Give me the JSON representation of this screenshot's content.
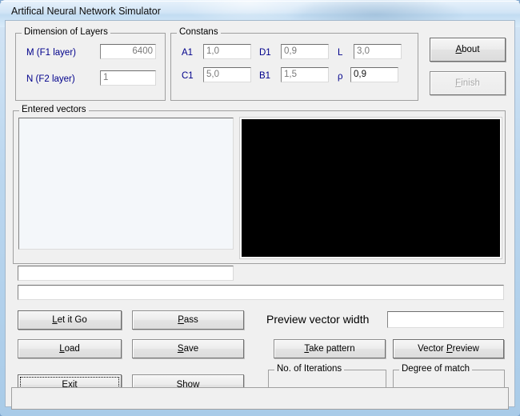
{
  "window": {
    "title": "Artifical Neural Network Simulator"
  },
  "dimension_group": {
    "legend": "Dimension of Layers",
    "fields": [
      {
        "label": "M (F1 layer)",
        "value": "6400",
        "align": "right"
      },
      {
        "label": "N (F2 layer)",
        "value": "1",
        "align": "left"
      }
    ]
  },
  "constants_group": {
    "legend": "Constans",
    "fields": [
      {
        "label": "A1",
        "value": "1,0"
      },
      {
        "label": "D1",
        "value": "0,9"
      },
      {
        "label": "L",
        "value": "3,0"
      },
      {
        "label": "C1",
        "value": "5,0"
      },
      {
        "label": "B1",
        "value": "1,5"
      },
      {
        "label": "ρ",
        "value": "0,9"
      }
    ]
  },
  "top_buttons": {
    "about": {
      "label_pre": "",
      "accel": "A",
      "label_post": "bout",
      "disabled": false
    },
    "finish": {
      "label_pre": "",
      "accel": "F",
      "label_post": "inish",
      "disabled": true
    }
  },
  "entered_vectors_group": {
    "legend": "Entered vectors",
    "listbox_value": "",
    "vector_field_value": "",
    "status_field_value": ""
  },
  "preview": {
    "panel_color": "#000000"
  },
  "action_buttons": [
    {
      "name": "let-it-go-button",
      "pre": "",
      "accel": "L",
      "post": "et it Go"
    },
    {
      "name": "pass-button",
      "pre": "",
      "accel": "P",
      "post": "ass"
    },
    {
      "name": "load-button",
      "pre": "",
      "accel": "L",
      "post": "oad"
    },
    {
      "name": "save-button",
      "pre": "",
      "accel": "S",
      "post": "ave"
    },
    {
      "name": "take-pattern-button",
      "pre": "",
      "accel": "T",
      "post": "ake pattern"
    },
    {
      "name": "vector-preview-button",
      "pre": "Vector ",
      "accel": "P",
      "post": "review"
    },
    {
      "name": "exit-button",
      "pre": "",
      "accel": "E",
      "post": "xit"
    },
    {
      "name": "show-button",
      "pre": "Show",
      "accel": "",
      "post": ""
    }
  ],
  "preview_width": {
    "label": "Preview vector width",
    "value": ""
  },
  "iterations_group": {
    "legend": "No. of Iterations",
    "value": ""
  },
  "match_group": {
    "legend": "Degree of match",
    "value": ""
  },
  "bottom_panel": {
    "value": ""
  },
  "colors": {
    "label_blue": "#00008b",
    "client_bg": "#f0f0f0",
    "field_bg": "#ffffff",
    "listbox_bg": "#f4f7fa",
    "preview_black": "#000000"
  }
}
